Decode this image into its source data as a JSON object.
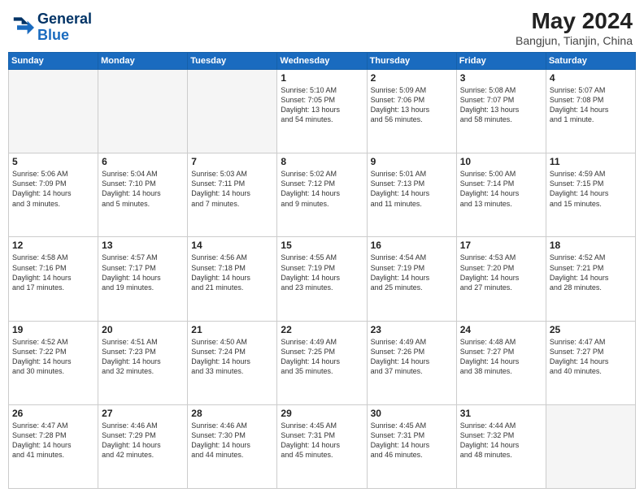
{
  "header": {
    "logo_line1": "General",
    "logo_line2": "Blue",
    "month_year": "May 2024",
    "location": "Bangjun, Tianjin, China"
  },
  "weekdays": [
    "Sunday",
    "Monday",
    "Tuesday",
    "Wednesday",
    "Thursday",
    "Friday",
    "Saturday"
  ],
  "weeks": [
    [
      {
        "day": "",
        "info": ""
      },
      {
        "day": "",
        "info": ""
      },
      {
        "day": "",
        "info": ""
      },
      {
        "day": "1",
        "info": "Sunrise: 5:10 AM\nSunset: 7:05 PM\nDaylight: 13 hours\nand 54 minutes."
      },
      {
        "day": "2",
        "info": "Sunrise: 5:09 AM\nSunset: 7:06 PM\nDaylight: 13 hours\nand 56 minutes."
      },
      {
        "day": "3",
        "info": "Sunrise: 5:08 AM\nSunset: 7:07 PM\nDaylight: 13 hours\nand 58 minutes."
      },
      {
        "day": "4",
        "info": "Sunrise: 5:07 AM\nSunset: 7:08 PM\nDaylight: 14 hours\nand 1 minute."
      }
    ],
    [
      {
        "day": "5",
        "info": "Sunrise: 5:06 AM\nSunset: 7:09 PM\nDaylight: 14 hours\nand 3 minutes."
      },
      {
        "day": "6",
        "info": "Sunrise: 5:04 AM\nSunset: 7:10 PM\nDaylight: 14 hours\nand 5 minutes."
      },
      {
        "day": "7",
        "info": "Sunrise: 5:03 AM\nSunset: 7:11 PM\nDaylight: 14 hours\nand 7 minutes."
      },
      {
        "day": "8",
        "info": "Sunrise: 5:02 AM\nSunset: 7:12 PM\nDaylight: 14 hours\nand 9 minutes."
      },
      {
        "day": "9",
        "info": "Sunrise: 5:01 AM\nSunset: 7:13 PM\nDaylight: 14 hours\nand 11 minutes."
      },
      {
        "day": "10",
        "info": "Sunrise: 5:00 AM\nSunset: 7:14 PM\nDaylight: 14 hours\nand 13 minutes."
      },
      {
        "day": "11",
        "info": "Sunrise: 4:59 AM\nSunset: 7:15 PM\nDaylight: 14 hours\nand 15 minutes."
      }
    ],
    [
      {
        "day": "12",
        "info": "Sunrise: 4:58 AM\nSunset: 7:16 PM\nDaylight: 14 hours\nand 17 minutes."
      },
      {
        "day": "13",
        "info": "Sunrise: 4:57 AM\nSunset: 7:17 PM\nDaylight: 14 hours\nand 19 minutes."
      },
      {
        "day": "14",
        "info": "Sunrise: 4:56 AM\nSunset: 7:18 PM\nDaylight: 14 hours\nand 21 minutes."
      },
      {
        "day": "15",
        "info": "Sunrise: 4:55 AM\nSunset: 7:19 PM\nDaylight: 14 hours\nand 23 minutes."
      },
      {
        "day": "16",
        "info": "Sunrise: 4:54 AM\nSunset: 7:19 PM\nDaylight: 14 hours\nand 25 minutes."
      },
      {
        "day": "17",
        "info": "Sunrise: 4:53 AM\nSunset: 7:20 PM\nDaylight: 14 hours\nand 27 minutes."
      },
      {
        "day": "18",
        "info": "Sunrise: 4:52 AM\nSunset: 7:21 PM\nDaylight: 14 hours\nand 28 minutes."
      }
    ],
    [
      {
        "day": "19",
        "info": "Sunrise: 4:52 AM\nSunset: 7:22 PM\nDaylight: 14 hours\nand 30 minutes."
      },
      {
        "day": "20",
        "info": "Sunrise: 4:51 AM\nSunset: 7:23 PM\nDaylight: 14 hours\nand 32 minutes."
      },
      {
        "day": "21",
        "info": "Sunrise: 4:50 AM\nSunset: 7:24 PM\nDaylight: 14 hours\nand 33 minutes."
      },
      {
        "day": "22",
        "info": "Sunrise: 4:49 AM\nSunset: 7:25 PM\nDaylight: 14 hours\nand 35 minutes."
      },
      {
        "day": "23",
        "info": "Sunrise: 4:49 AM\nSunset: 7:26 PM\nDaylight: 14 hours\nand 37 minutes."
      },
      {
        "day": "24",
        "info": "Sunrise: 4:48 AM\nSunset: 7:27 PM\nDaylight: 14 hours\nand 38 minutes."
      },
      {
        "day": "25",
        "info": "Sunrise: 4:47 AM\nSunset: 7:27 PM\nDaylight: 14 hours\nand 40 minutes."
      }
    ],
    [
      {
        "day": "26",
        "info": "Sunrise: 4:47 AM\nSunset: 7:28 PM\nDaylight: 14 hours\nand 41 minutes."
      },
      {
        "day": "27",
        "info": "Sunrise: 4:46 AM\nSunset: 7:29 PM\nDaylight: 14 hours\nand 42 minutes."
      },
      {
        "day": "28",
        "info": "Sunrise: 4:46 AM\nSunset: 7:30 PM\nDaylight: 14 hours\nand 44 minutes."
      },
      {
        "day": "29",
        "info": "Sunrise: 4:45 AM\nSunset: 7:31 PM\nDaylight: 14 hours\nand 45 minutes."
      },
      {
        "day": "30",
        "info": "Sunrise: 4:45 AM\nSunset: 7:31 PM\nDaylight: 14 hours\nand 46 minutes."
      },
      {
        "day": "31",
        "info": "Sunrise: 4:44 AM\nSunset: 7:32 PM\nDaylight: 14 hours\nand 48 minutes."
      },
      {
        "day": "",
        "info": ""
      }
    ]
  ]
}
